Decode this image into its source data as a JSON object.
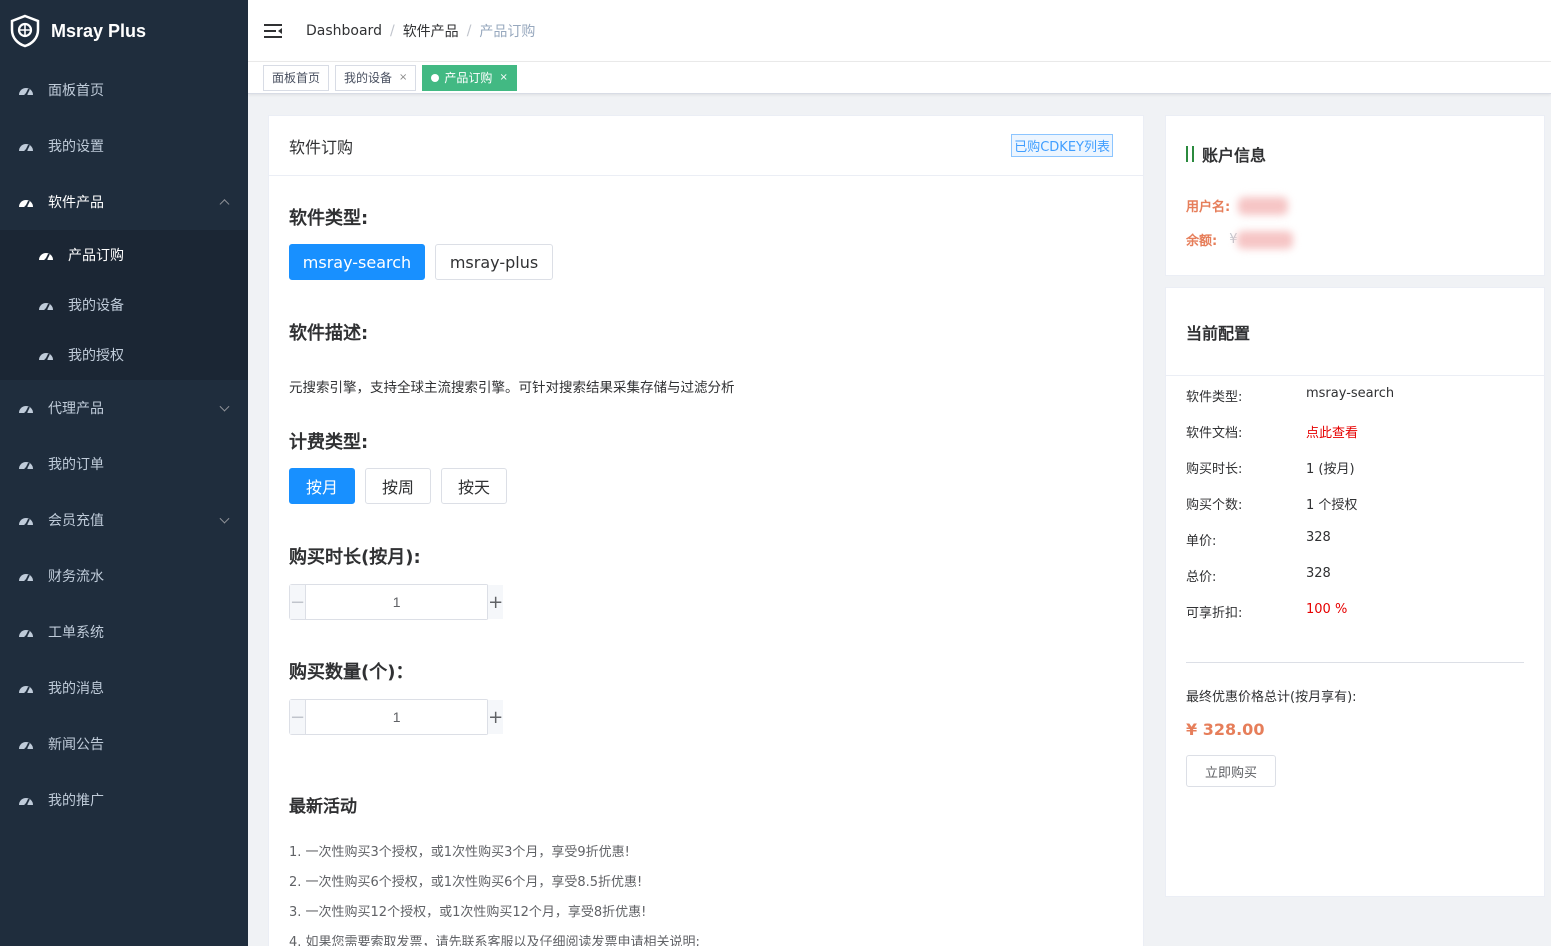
{
  "app": {
    "brand": "Msray Plus"
  },
  "sidebar": {
    "items": [
      {
        "label": "面板首页"
      },
      {
        "label": "我的设置"
      },
      {
        "label": "软件产品",
        "expanded": true,
        "children": [
          {
            "label": "产品订购",
            "active": true
          },
          {
            "label": "我的设备"
          },
          {
            "label": "我的授权"
          }
        ]
      },
      {
        "label": "代理产品"
      },
      {
        "label": "我的订单"
      },
      {
        "label": "会员充值"
      },
      {
        "label": "财务流水"
      },
      {
        "label": "工单系统"
      },
      {
        "label": "我的消息"
      },
      {
        "label": "新闻公告"
      },
      {
        "label": "我的推广"
      }
    ]
  },
  "header": {
    "breadcrumb": [
      "Dashboard",
      "软件产品",
      "产品订购"
    ]
  },
  "tags": [
    {
      "label": "面板首页"
    },
    {
      "label": "我的设备",
      "close": "×"
    },
    {
      "label": "产品订购",
      "close": "×",
      "active": true
    }
  ],
  "order": {
    "title": "软件订购",
    "cdkey_button": "已购CDKEY列表",
    "software_type_label": "软件类型:",
    "software_types": [
      "msray-search",
      "msray-plus"
    ],
    "selected_type": "msray-search",
    "description_label": "软件描述:",
    "description": "元搜索引擎，支持全球主流搜索引擎。可针对搜索结果采集存储与过滤分析",
    "billing_label": "计费类型:",
    "billing_types": [
      "按月",
      "按周",
      "按天"
    ],
    "selected_billing": "按月",
    "duration_label": "购买时长(按月):",
    "duration_value": "1",
    "quantity_label": "购买数量(个)：",
    "quantity_value": "1",
    "stepper_minus": "−",
    "stepper_plus": "+",
    "promo_title": "最新活动",
    "promos": [
      "1. 一次性购买3个授权，或1次性购买3个月，享受9折优惠!",
      "2. 一次性购买6个授权，或1次性购买6个月，享受8.5折优惠!",
      "3. 一次性购买12个授权，或1次性购买12个月，享受8折优惠!",
      "4. 如果您需要索取发票，请先联系客服以及仔细阅读发票申请相关说明;"
    ]
  },
  "account": {
    "title": "账户信息",
    "username_label": "用户名:",
    "balance_label": "余额:",
    "balance_prefix": "¥"
  },
  "config": {
    "title": "当前配置",
    "rows": [
      {
        "k": "软件类型:",
        "v": "msray-search"
      },
      {
        "k": "软件文档:",
        "v": "点此查看"
      },
      {
        "k": "购买时长:",
        "v": "1 (按月)"
      },
      {
        "k": "购买个数:",
        "v": "1 个授权"
      },
      {
        "k": "单价:",
        "v": "328"
      },
      {
        "k": "总价:",
        "v": "328"
      },
      {
        "k": "可享折扣:",
        "v": "100 %"
      }
    ],
    "total_label": "最终优惠价格总计(按月享有):",
    "total_value": "¥ 328.00",
    "buy_button": "立即购买"
  },
  "colors": {
    "sidebar_bg": "#1f2d3d",
    "primary": "#1890ff",
    "tag_active": "#42b983",
    "accent_orange": "#e67e5a",
    "red": "#e60000"
  }
}
